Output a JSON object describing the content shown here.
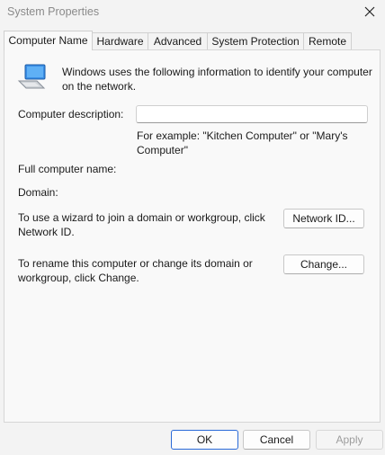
{
  "window": {
    "title": "System Properties"
  },
  "icons": {
    "close": "close-icon",
    "computer": "computer-icon"
  },
  "tabs": [
    {
      "label": "Computer Name",
      "active": true
    },
    {
      "label": "Hardware",
      "active": false
    },
    {
      "label": "Advanced",
      "active": false
    },
    {
      "label": "System Protection",
      "active": false
    },
    {
      "label": "Remote",
      "active": false
    }
  ],
  "main": {
    "intro": "Windows uses the following information to identify your computer on the network.",
    "description_label": "Computer description:",
    "description_value": "",
    "description_example": "For example: \"Kitchen Computer\" or \"Mary's Computer\"",
    "full_name_label": "Full computer name:",
    "domain_label": "Domain:",
    "network_text": "To use a wizard to join a domain or workgroup, click Network ID.",
    "network_button": "Network ID...",
    "rename_text": "To rename this computer or change its domain or workgroup, click Change.",
    "change_button": "Change..."
  },
  "footer": {
    "ok": "OK",
    "cancel": "Cancel",
    "apply": "Apply"
  },
  "colors": {
    "accent": "#2a6ad8",
    "background": "#f3f3f3",
    "panel": "#f9f9f9"
  }
}
